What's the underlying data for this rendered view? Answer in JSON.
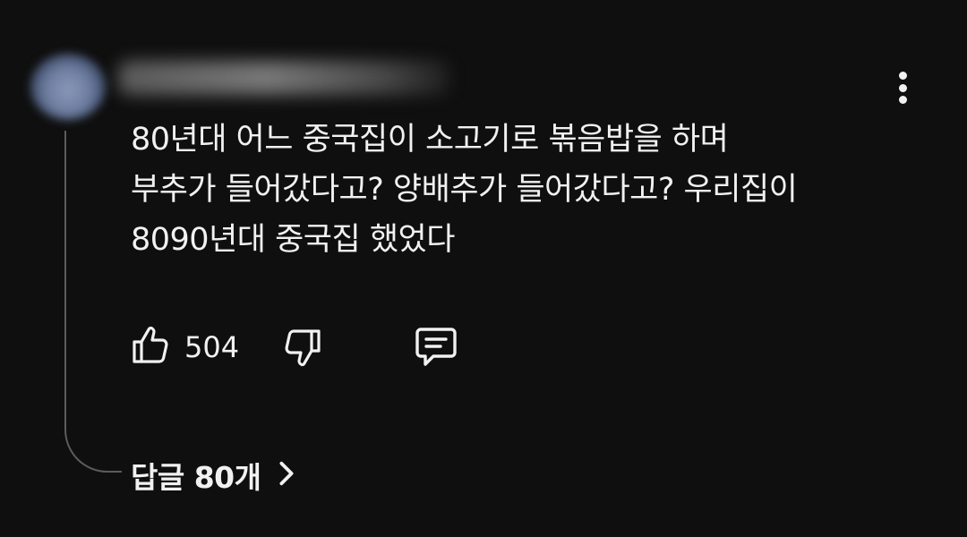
{
  "comment": {
    "author": {
      "avatar_icon": "blurred-avatar",
      "name_redacted": true
    },
    "lines": [
      "80년대 어느 중국집이 소고기로 볶음밥을 하며",
      "부추가 들어갔다고? 양배추가 들어갔다고? 우리집이",
      "8090년대 중국집 했었다"
    ],
    "actions": {
      "like_icon": "thumbs-up-icon",
      "like_count": "504",
      "dislike_icon": "thumbs-down-icon",
      "reply_icon": "comment-icon"
    },
    "more_icon": "more-vert-icon",
    "replies": {
      "label": "답글 80개",
      "chevron_icon": "chevron-right-icon"
    }
  },
  "theme": {
    "background": "#0f0f0f",
    "text": "#f1f1f1",
    "thread_line": "#5c5c5c"
  }
}
